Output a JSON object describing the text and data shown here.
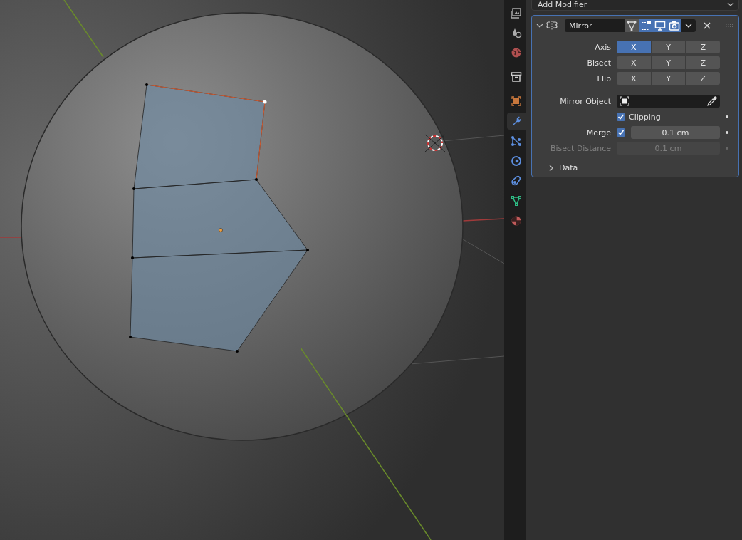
{
  "tabs": [
    {
      "kind": "output",
      "selected": false
    },
    {
      "kind": "scene",
      "selected": false
    },
    {
      "kind": "world",
      "selected": false
    },
    {
      "kind": "collection",
      "selected": false
    },
    {
      "kind": "object",
      "selected": false
    },
    {
      "kind": "modifiers",
      "selected": true
    },
    {
      "kind": "particles",
      "selected": false
    },
    {
      "kind": "physics",
      "selected": false
    },
    {
      "kind": "constraints",
      "selected": false
    },
    {
      "kind": "data",
      "selected": false
    },
    {
      "kind": "material",
      "selected": false
    }
  ],
  "add_modifier": {
    "label": "Add Modifier"
  },
  "modifier": {
    "name": "Mirror",
    "expanded": true,
    "toggles": [
      {
        "kind": "cage",
        "on": false
      },
      {
        "kind": "edit-mode",
        "on": true
      },
      {
        "kind": "viewport",
        "on": true
      },
      {
        "kind": "render",
        "on": true
      }
    ],
    "axis_rows": [
      {
        "label": "Axis",
        "buttons": [
          {
            "label": "X",
            "selected": true
          },
          {
            "label": "Y",
            "selected": false
          },
          {
            "label": "Z",
            "selected": false
          }
        ]
      },
      {
        "label": "Bisect",
        "buttons": [
          {
            "label": "X",
            "selected": false
          },
          {
            "label": "Y",
            "selected": false
          },
          {
            "label": "Z",
            "selected": false
          }
        ]
      },
      {
        "label": "Flip",
        "buttons": [
          {
            "label": "X",
            "selected": false
          },
          {
            "label": "Y",
            "selected": false
          },
          {
            "label": "Z",
            "selected": false
          }
        ]
      }
    ],
    "mirror_object": {
      "label": "Mirror Object"
    },
    "clipping": {
      "label": "Clipping",
      "checked": true
    },
    "merge": {
      "label": "Merge",
      "checked": true,
      "value": "0.1 cm"
    },
    "bisect_distance": {
      "label": "Bisect Distance",
      "value": "0.1 cm",
      "disabled": true
    },
    "data_panel": {
      "label": "Data",
      "expanded": false
    }
  }
}
